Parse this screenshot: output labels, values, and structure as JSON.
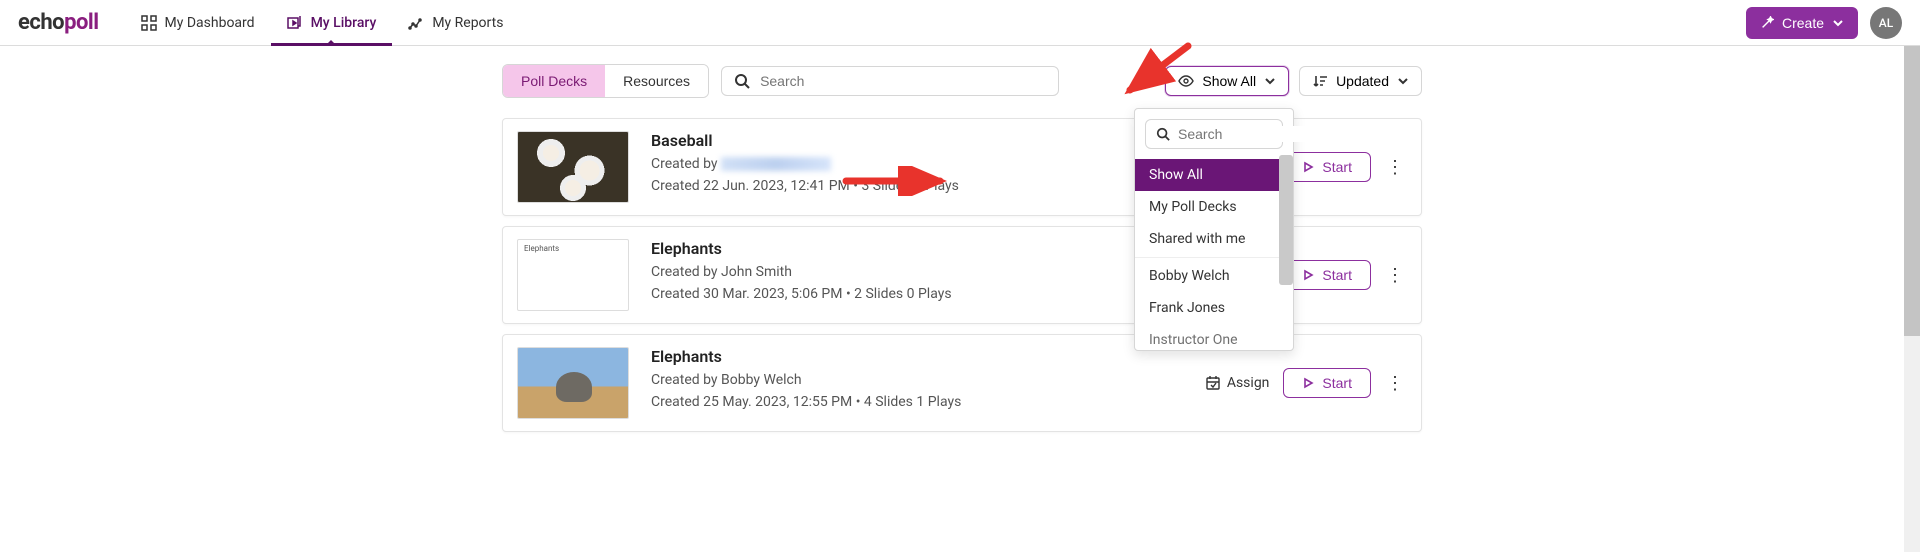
{
  "brand": {
    "p1": "echo",
    "p2": "poll"
  },
  "nav": {
    "dashboard": "My Dashboard",
    "library": "My Library",
    "reports": "My Reports"
  },
  "create_label": "Create",
  "avatar_initials": "AL",
  "tabs": {
    "poll_decks": "Poll Decks",
    "resources": "Resources"
  },
  "search_placeholder": "Search",
  "filter": {
    "label": "Show All"
  },
  "sort": {
    "label": "Updated"
  },
  "dropdown": {
    "search_placeholder": "Search",
    "items": [
      "Show All",
      "My Poll Decks",
      "Shared with me",
      "Bobby Welch",
      "Frank Jones",
      "Instructor One"
    ]
  },
  "cards": [
    {
      "title": "Baseball",
      "created_by_prefix": "Created by ",
      "author": "",
      "author_blurred": true,
      "meta": "Created 22 Jun. 2023, 12:41 PM • 3 Slides 0 Plays",
      "thumb": "baseball"
    },
    {
      "title": "Elephants",
      "created_by_prefix": "Created by  ",
      "author": "John Smith",
      "author_blurred": false,
      "meta": "Created 30 Mar. 2023, 5:06 PM • 2 Slides 0 Plays",
      "thumb": "label-only",
      "thumb_label": "Elephants"
    },
    {
      "title": "Elephants",
      "created_by_prefix": "Created by  ",
      "author": "Bobby Welch",
      "author_blurred": false,
      "meta": "Created 25 May. 2023, 12:55 PM • 4 Slides 1 Plays",
      "thumb": "elephant"
    }
  ],
  "actions": {
    "assign": "Assign",
    "start": "Start"
  }
}
